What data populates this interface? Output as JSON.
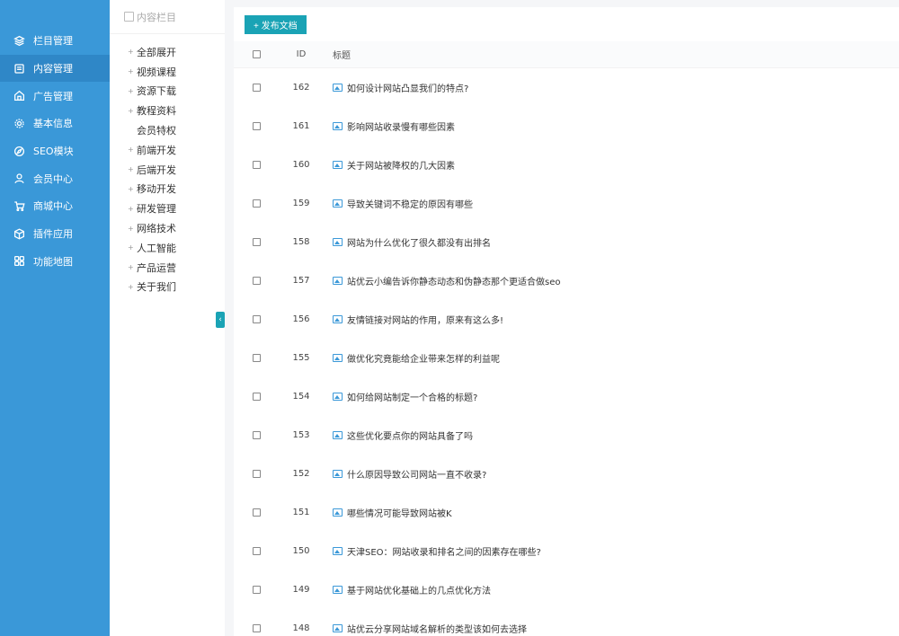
{
  "nav": {
    "items": [
      {
        "label": "栏目管理",
        "icon": "layers-icon"
      },
      {
        "label": "内容管理",
        "icon": "document-icon",
        "active": true
      },
      {
        "label": "广告管理",
        "icon": "house-icon"
      },
      {
        "label": "基本信息",
        "icon": "gear-icon"
      },
      {
        "label": "SEO模块",
        "icon": "compass-icon"
      },
      {
        "label": "会员中心",
        "icon": "user-icon"
      },
      {
        "label": "商城中心",
        "icon": "cart-icon"
      },
      {
        "label": "插件应用",
        "icon": "box-icon"
      },
      {
        "label": "功能地图",
        "icon": "grid-icon"
      }
    ]
  },
  "tree": {
    "header": "内容栏目",
    "items": [
      {
        "label": "全部展开",
        "expandable": true
      },
      {
        "label": "视频课程",
        "expandable": true
      },
      {
        "label": "资源下载",
        "expandable": true
      },
      {
        "label": "教程资料",
        "expandable": true
      },
      {
        "label": "会员特权",
        "expandable": false
      },
      {
        "label": "前端开发",
        "expandable": true
      },
      {
        "label": "后端开发",
        "expandable": true
      },
      {
        "label": "移动开发",
        "expandable": true
      },
      {
        "label": "研发管理",
        "expandable": true
      },
      {
        "label": "网络技术",
        "expandable": true
      },
      {
        "label": "人工智能",
        "expandable": true
      },
      {
        "label": "产品运营",
        "expandable": true
      },
      {
        "label": "关于我们",
        "expandable": true
      }
    ],
    "collapse_glyph": "‹"
  },
  "toolbar": {
    "publish_label": "+ 发布文档"
  },
  "table": {
    "headers": {
      "id": "ID",
      "title": "标题"
    },
    "rows": [
      {
        "id": "162",
        "title": "如何设计网站凸显我们的特点?"
      },
      {
        "id": "161",
        "title": "影响网站收录慢有哪些因素"
      },
      {
        "id": "160",
        "title": "关于网站被降权的几大因素"
      },
      {
        "id": "159",
        "title": "导致关键词不稳定的原因有哪些"
      },
      {
        "id": "158",
        "title": "网站为什么优化了很久都没有出排名"
      },
      {
        "id": "157",
        "title": "站优云小编告诉你静态动态和伪静态那个更适合做seo"
      },
      {
        "id": "156",
        "title": "友情链接对网站的作用，原来有这么多!"
      },
      {
        "id": "155",
        "title": "做优化究竟能给企业带来怎样的利益呢"
      },
      {
        "id": "154",
        "title": "如何给网站制定一个合格的标题?"
      },
      {
        "id": "153",
        "title": "这些优化要点你的网站具备了吗"
      },
      {
        "id": "152",
        "title": "什么原因导致公司网站一直不收录?"
      },
      {
        "id": "151",
        "title": "哪些情况可能导致网站被K"
      },
      {
        "id": "150",
        "title": "天津SEO：网站收录和排名之间的因素存在哪些?"
      },
      {
        "id": "149",
        "title": "基于网站优化基础上的几点优化方法"
      },
      {
        "id": "148",
        "title": "站优云分享网站域名解析的类型该如何去选择"
      }
    ]
  }
}
